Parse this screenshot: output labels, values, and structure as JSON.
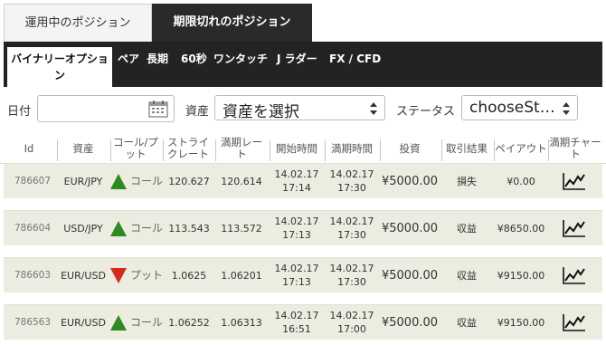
{
  "top_tabs": [
    {
      "label": "運用中のポジション",
      "active": false
    },
    {
      "label": "期限切れのポジション",
      "active": true
    }
  ],
  "categories": [
    {
      "label": "バイナリーオプション",
      "active": true
    },
    {
      "label": "ペア"
    },
    {
      "label": "長期"
    },
    {
      "label": "60秒"
    },
    {
      "label": "ワンタッチ"
    },
    {
      "label": "J ラダー"
    },
    {
      "label": "FX / CFD"
    }
  ],
  "filter": {
    "date_label": "日付",
    "date_value": "",
    "asset_label": "資産",
    "asset_value": "資産を選択",
    "status_label": "ステータス",
    "status_value": "chooseSt…"
  },
  "columns": [
    "Id",
    "資産",
    "コール/プット",
    "ストライクレート",
    "満期レート",
    "開始時間",
    "満期時間",
    "投資",
    "取引結果",
    "ペイアウト",
    "満期チャート"
  ],
  "rows": [
    {
      "id": "786607",
      "asset": "EUR/JPY",
      "direction": "up",
      "direction_label": "コール",
      "strike": "120.627",
      "expiry_rate": "120.614",
      "start_date": "14.02.17",
      "start_time": "17:14",
      "end_date": "14.02.17",
      "end_time": "17:30",
      "investment": "¥5000.00",
      "result": "損失",
      "payout": "¥0.00"
    },
    {
      "id": "786604",
      "asset": "USD/JPY",
      "direction": "up",
      "direction_label": "コール",
      "strike": "113.543",
      "expiry_rate": "113.572",
      "start_date": "14.02.17",
      "start_time": "17:13",
      "end_date": "14.02.17",
      "end_time": "17:30",
      "investment": "¥5000.00",
      "result": "収益",
      "payout": "¥8650.00"
    },
    {
      "id": "786603",
      "asset": "EUR/USD",
      "direction": "down",
      "direction_label": "プット",
      "strike": "1.0625",
      "expiry_rate": "1.06201",
      "start_date": "14.02.17",
      "start_time": "17:13",
      "end_date": "14.02.17",
      "end_time": "17:30",
      "investment": "¥5000.00",
      "result": "収益",
      "payout": "¥9150.00"
    },
    {
      "id": "786563",
      "asset": "EUR/USD",
      "direction": "up",
      "direction_label": "コール",
      "strike": "1.06252",
      "expiry_rate": "1.06313",
      "start_date": "14.02.17",
      "start_time": "16:51",
      "end_date": "14.02.17",
      "end_time": "17:00",
      "investment": "¥5000.00",
      "result": "収益",
      "payout": "¥9150.00"
    }
  ],
  "icons": {
    "calendar": "calendar-icon",
    "select_arrows": "select-arrows-icon",
    "call": "call-up-triangle-icon",
    "put": "put-down-triangle-icon",
    "chart": "chart-line-icon"
  },
  "colors": {
    "dark_bar": "#232323",
    "active_tab": "#2a2a2a",
    "row_bg": "#ecece1",
    "call_green": "#2e8b22",
    "put_red": "#d52b1e"
  }
}
